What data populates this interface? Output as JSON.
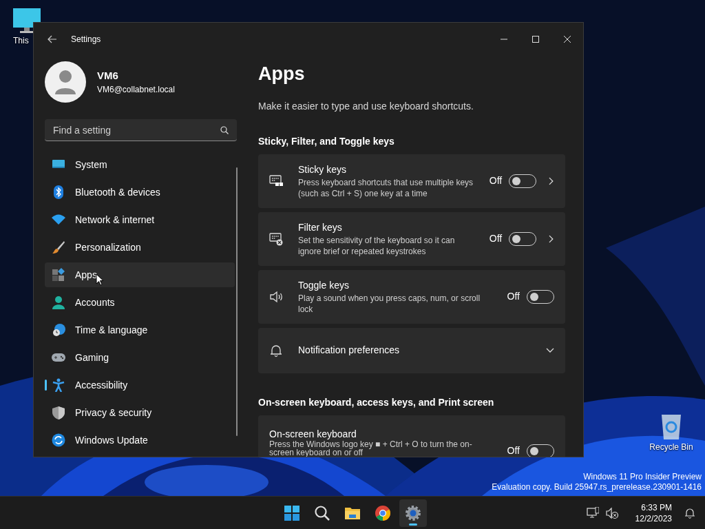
{
  "desktop": {
    "icons": [
      {
        "kind": "pc",
        "label": "This"
      },
      {
        "kind": "bin",
        "label": "Recycle Bin"
      }
    ],
    "notice": [
      "Windows 11 Pro Insider Preview",
      "Evaluation copy. Build 25947.rs_prerelease.230901-1416"
    ]
  },
  "window": {
    "title": "Settings"
  },
  "account": {
    "name": "VM6",
    "email": "VM6@collabnet.local"
  },
  "search": {
    "placeholder": "Find a setting"
  },
  "sidebar": {
    "items": [
      {
        "label": "System",
        "selected": false,
        "hovered": false
      },
      {
        "label": "Bluetooth & devices",
        "selected": false,
        "hovered": false
      },
      {
        "label": "Network & internet",
        "selected": false,
        "hovered": false
      },
      {
        "label": "Personalization",
        "selected": false,
        "hovered": false
      },
      {
        "label": "Apps",
        "selected": false,
        "hovered": true
      },
      {
        "label": "Accounts",
        "selected": false,
        "hovered": false
      },
      {
        "label": "Time & language",
        "selected": false,
        "hovered": false
      },
      {
        "label": "Gaming",
        "selected": false,
        "hovered": false
      },
      {
        "label": "Accessibility",
        "selected": true,
        "hovered": false
      },
      {
        "label": "Privacy & security",
        "selected": false,
        "hovered": false
      },
      {
        "label": "Windows Update",
        "selected": false,
        "hovered": false
      }
    ]
  },
  "page": {
    "title": "Apps",
    "description": "Make it easier to type and use keyboard shortcuts.",
    "sections": [
      {
        "heading": "Sticky, Filter, and Toggle keys",
        "rows": [
          {
            "kind": "toggle",
            "title": "Sticky keys",
            "description": "Press keyboard shortcuts that use multiple keys (such as Ctrl + S) one key at a time",
            "state_label": "Off",
            "on": false,
            "chevron": true
          },
          {
            "kind": "toggle",
            "title": "Filter keys",
            "description": "Set the sensitivity of the keyboard so it can ignore brief or repeated keystrokes",
            "state_label": "Off",
            "on": false,
            "chevron": true
          },
          {
            "kind": "toggle",
            "title": "Toggle keys",
            "description": "Play a sound when you press caps, num, or scroll lock",
            "state_label": "Off",
            "on": false,
            "chevron": false
          },
          {
            "kind": "expander",
            "title": "Notification preferences",
            "expanded": false
          }
        ]
      },
      {
        "heading": "On-screen keyboard, access keys, and Print screen",
        "rows": [
          {
            "kind": "toggle",
            "title": "On-screen keyboard",
            "description": "Press the Windows logo key ■ + Ctrl + O to turn the on-screen keyboard on or off",
            "state_label": "Off",
            "on": false,
            "chevron": false
          }
        ]
      }
    ]
  },
  "taskbar": {
    "apps": [
      {
        "kind": "start",
        "running": false
      },
      {
        "kind": "search",
        "running": false
      },
      {
        "kind": "explorer",
        "running": false
      },
      {
        "kind": "chrome",
        "running": false
      },
      {
        "kind": "settings",
        "running": true
      }
    ],
    "tray": [
      {
        "kind": "network"
      },
      {
        "kind": "muted"
      }
    ],
    "clock": {
      "time": "6:33 PM",
      "date": "12/2/2023"
    }
  }
}
